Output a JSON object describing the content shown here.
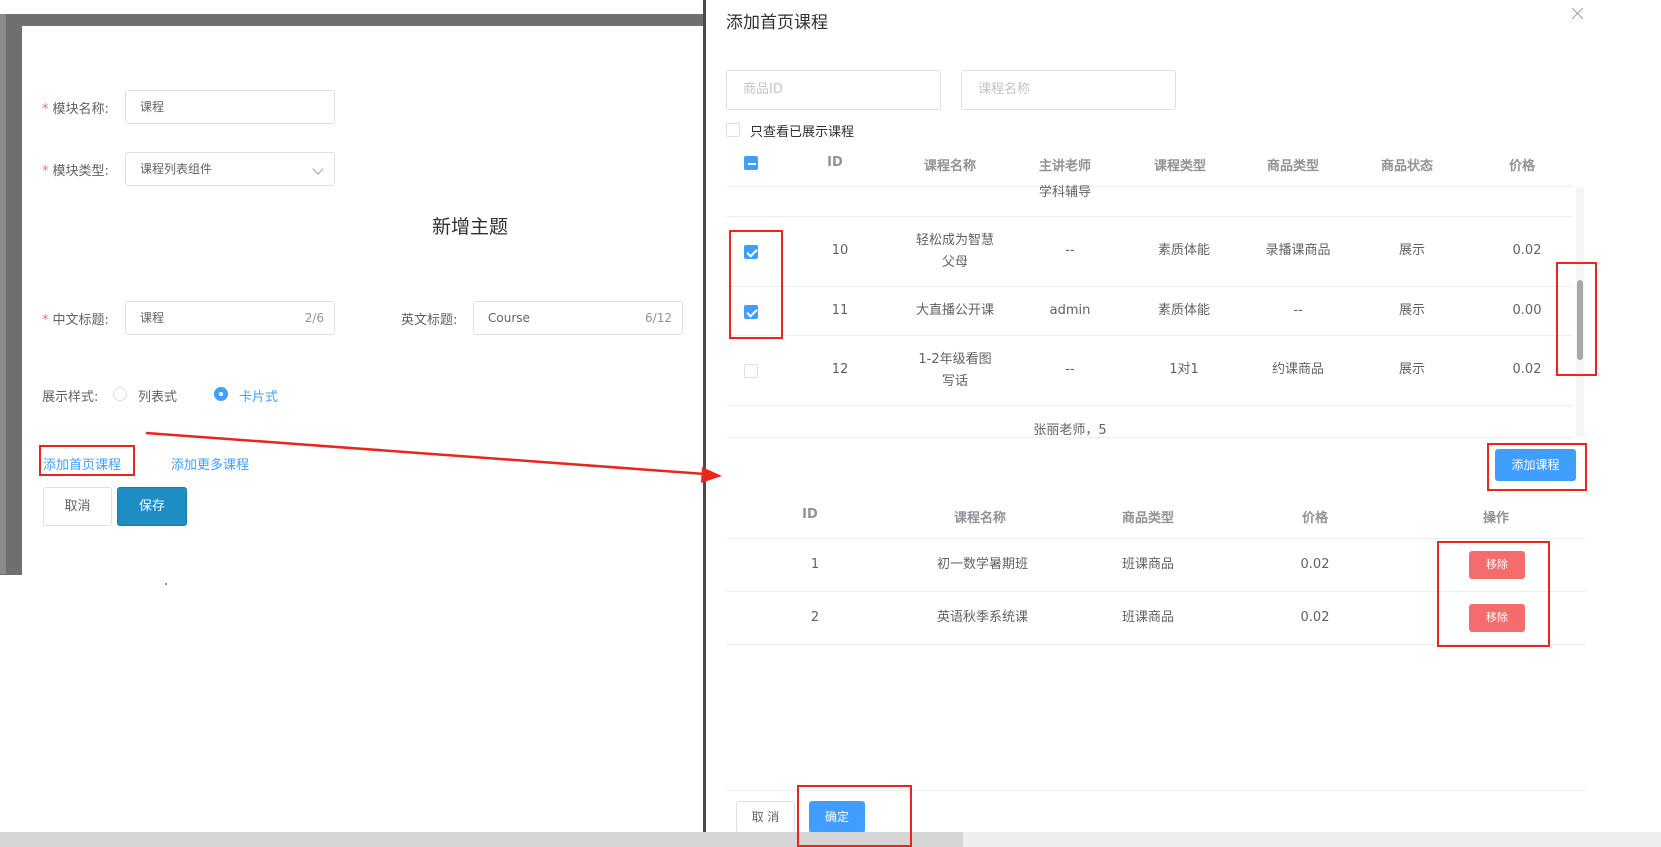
{
  "left_form": {
    "module_name_label": "模块名称:",
    "module_name_value": "课程",
    "module_type_label": "模块类型:",
    "module_type_value": "课程列表组件",
    "section_title": "新增主题",
    "cn_title_label": "中文标题:",
    "cn_title_value": "课程",
    "cn_title_count": "2/6",
    "en_title_label": "英文标题:",
    "en_title_value": "Course",
    "en_title_count": "6/12",
    "display_style_label": "展示样式:",
    "display_options": [
      "列表式",
      "卡片式"
    ],
    "display_selected": "卡片式",
    "add_home_course_link": "添加首页课程",
    "add_more_course_link": "添加更多课程",
    "cancel_label": "取消",
    "save_label": "保存",
    "required_mark": "*"
  },
  "dialog": {
    "title": "添加首页课程",
    "search_id_placeholder": "商品ID",
    "search_name_placeholder": "课程名称",
    "only_shown_label": "只查看已展示课程",
    "columns": [
      "ID",
      "课程名称",
      "主讲老师",
      "课程类型",
      "商品类型",
      "商品状态",
      "价格"
    ],
    "top_cut_text": "学科辅导",
    "rows": [
      {
        "id": "10",
        "name_line1": "轻松成为智慧",
        "name_line2": "父母",
        "teacher": "--",
        "course_type": "素质体能",
        "goods_type": "录播课商品",
        "status": "展示",
        "price": "0.02",
        "checked": true
      },
      {
        "id": "11",
        "name_line1": "大直播公开课",
        "name_line2": "",
        "teacher": "admin",
        "course_type": "素质体能",
        "goods_type": "--",
        "status": "展示",
        "price": "0.00",
        "checked": true
      },
      {
        "id": "12",
        "name_line1": "1-2年级看图",
        "name_line2": "写话",
        "teacher": "--",
        "course_type": "1对1",
        "goods_type": "约课商品",
        "status": "展示",
        "price": "0.02",
        "checked": false
      }
    ],
    "bottom_cut_text": "张丽老师，5",
    "add_course_button": "添加课程",
    "selected_columns": [
      "ID",
      "课程名称",
      "商品类型",
      "价格",
      "操作"
    ],
    "selected_rows": [
      {
        "id": "1",
        "name": "初一数学暑期班",
        "goods_type": "班课商品",
        "price": "0.02",
        "action": "移除"
      },
      {
        "id": "2",
        "name": "英语秋季系统课",
        "goods_type": "班课商品",
        "price": "0.02",
        "action": "移除"
      }
    ],
    "cancel_label": "取 消",
    "confirm_label": "确定"
  },
  "colors": {
    "primary": "#409eff",
    "danger": "#f56c6c",
    "annotation_red": "#e8261e",
    "save_button": "#1d8dc4"
  }
}
